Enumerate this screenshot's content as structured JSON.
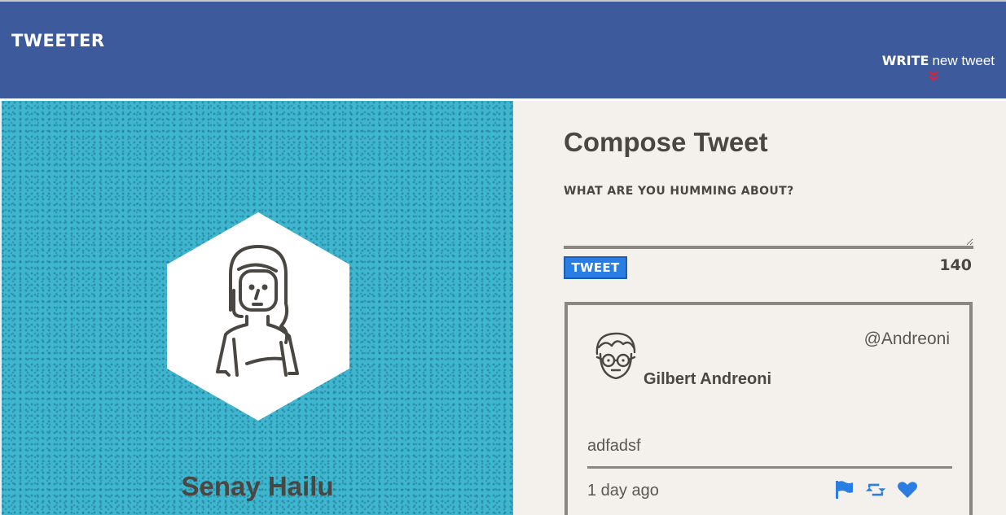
{
  "header": {
    "brand": "Tweeter",
    "compose_toggle": {
      "bold_label": "Write",
      "label": "new tweet",
      "icon": "double-chevron-down-icon"
    },
    "background_color": "#3d5a9c"
  },
  "profile": {
    "name": "Senay Hailu",
    "avatar_icon": "woman-avatar-icon",
    "background_color": "#3fb6cf"
  },
  "compose": {
    "title": "Compose Tweet",
    "prompt": "What are you humming about?",
    "textarea_value": "",
    "submit_label": "Tweet",
    "char_counter": "140",
    "button_color": "#2a7ee3"
  },
  "tweets": [
    {
      "author_name": "Gilbert Andreoni",
      "handle": "@Andreoni",
      "avatar_icon": "man-with-glasses-avatar-icon",
      "content": "adfadsf",
      "timestamp": "1 day ago",
      "actions": [
        "flag-icon",
        "retweet-icon",
        "heart-icon"
      ],
      "action_color": "#2a7ee3"
    }
  ]
}
